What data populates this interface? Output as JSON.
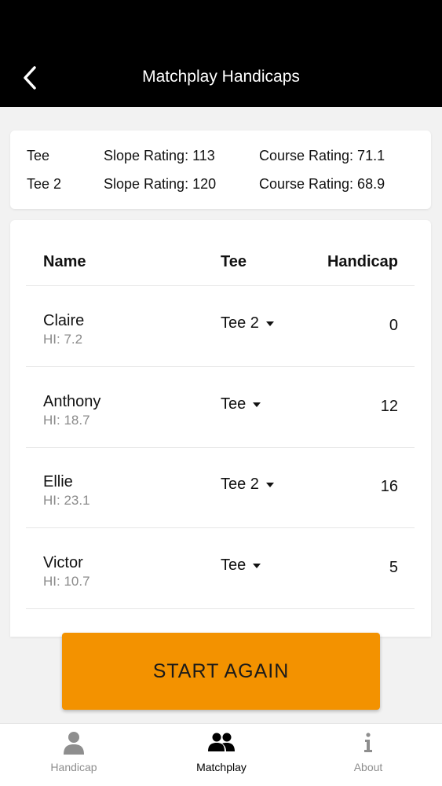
{
  "header": {
    "title": "Matchplay Handicaps"
  },
  "ratings": [
    {
      "tee": "Tee",
      "slope": "Slope Rating: 113",
      "course": "Course Rating: 71.1"
    },
    {
      "tee": "Tee 2",
      "slope": "Slope Rating: 120",
      "course": "Course Rating: 68.9"
    }
  ],
  "table": {
    "headers": {
      "name": "Name",
      "tee": "Tee",
      "handicap": "Handicap"
    },
    "players": [
      {
        "name": "Claire",
        "hi": "HI: 7.2",
        "tee": "Tee 2",
        "handicap": "0"
      },
      {
        "name": "Anthony",
        "hi": "HI: 18.7",
        "tee": "Tee",
        "handicap": "12"
      },
      {
        "name": "Ellie",
        "hi": "HI: 23.1",
        "tee": "Tee 2",
        "handicap": "16"
      },
      {
        "name": "Victor",
        "hi": "HI: 10.7",
        "tee": "Tee",
        "handicap": "5"
      }
    ]
  },
  "actions": {
    "start_again": "START AGAIN"
  },
  "tabs": [
    {
      "label": "Handicap",
      "icon": "person-icon",
      "active": false
    },
    {
      "label": "Matchplay",
      "icon": "people-icon",
      "active": true
    },
    {
      "label": "About",
      "icon": "info-icon",
      "active": false
    }
  ],
  "colors": {
    "accent": "#f39200",
    "header_bg": "#000000",
    "muted_text": "#8a8a8a"
  }
}
